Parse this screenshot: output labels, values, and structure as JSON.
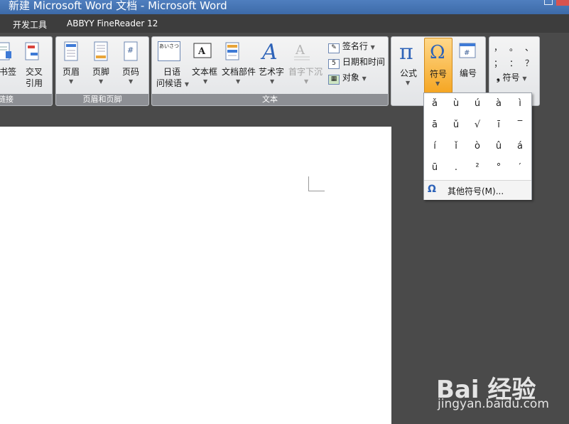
{
  "window": {
    "title": "新建 Microsoft Word 文档 - Microsoft Word"
  },
  "tabs": [
    {
      "label": "开发工具"
    },
    {
      "label": "ABBYY FineReader 12"
    }
  ],
  "ribbon": {
    "links_group": {
      "label": "链接",
      "buttons": [
        {
          "label": "书签"
        },
        {
          "label": "交叉",
          "label2": "引用"
        }
      ]
    },
    "header_footer_group": {
      "label": "页眉和页脚",
      "buttons": [
        {
          "label": "页眉"
        },
        {
          "label": "页脚"
        },
        {
          "label": "页码"
        }
      ]
    },
    "text_group": {
      "label": "文本",
      "greeting_icon_text": "あいさつ",
      "buttons": [
        {
          "label": "日语",
          "label2": "问候语"
        },
        {
          "label": "文本框"
        },
        {
          "label": "文档部件"
        },
        {
          "label": "艺术字"
        },
        {
          "label": "首字下沉"
        }
      ],
      "small_buttons": [
        {
          "label": "签名行"
        },
        {
          "label": "日期和时间"
        },
        {
          "label": "对象"
        }
      ]
    },
    "symbols_group": {
      "buttons": [
        {
          "label": "公式"
        },
        {
          "label": "符号"
        },
        {
          "label": "编号"
        }
      ]
    },
    "special_group": {
      "glyphs": [
        "，",
        "。",
        "、",
        "；",
        "：",
        "？"
      ],
      "button": {
        "label": "符号"
      }
    }
  },
  "symbol_dropdown": {
    "symbols": [
      "ǎ",
      "ù",
      "ú",
      "à",
      "ì",
      "ā",
      "ǔ",
      "√",
      "ī",
      "‾",
      "í",
      "ǐ",
      "ò",
      "û",
      "á",
      "ū",
      ".",
      "²",
      "°",
      "′"
    ],
    "more_label": "其他符号(M)..."
  },
  "watermark": {
    "logo": "Bai 经验",
    "url": "jingyan.baidu.com"
  }
}
